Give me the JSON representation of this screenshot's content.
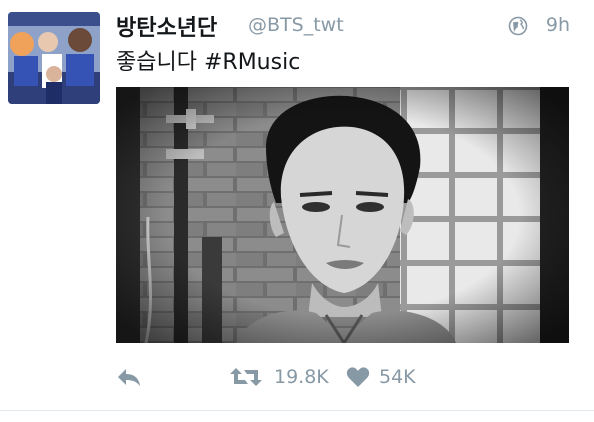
{
  "tweet": {
    "display_name": "방탄소년단",
    "handle": "@BTS_twt",
    "time": "9h",
    "text": "좋습니다",
    "hashtag": "#RMusic"
  },
  "actions": {
    "retweet_count": "19.8K",
    "like_count": "54K"
  },
  "colors": {
    "muted": "#8899a6",
    "text": "#14171a",
    "divider": "#e1e8ed"
  },
  "icons": [
    "globe-icon",
    "reply-icon",
    "retweet-icon",
    "heart-icon"
  ]
}
